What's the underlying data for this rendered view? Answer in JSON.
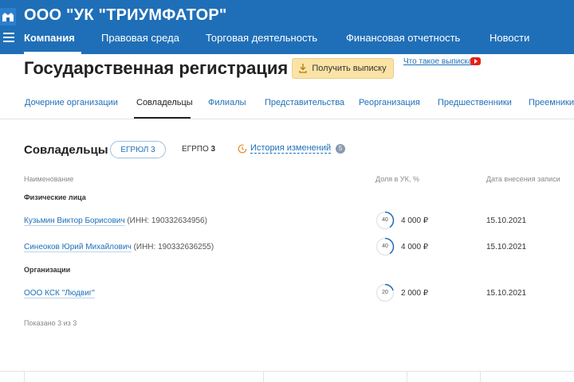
{
  "header": {
    "company_title": "ООО \"УК \"ТРИУМФАТОР\"",
    "nav": [
      {
        "label": "Компания",
        "active": true
      },
      {
        "label": "Правовая среда",
        "active": false
      },
      {
        "label": "Торговая деятельность",
        "active": false
      },
      {
        "label": "Финансовая отчетность",
        "active": false
      },
      {
        "label": "Новости",
        "active": false
      }
    ]
  },
  "page": {
    "title": "Государственная регистрация",
    "extract_button": "Получить выписку",
    "what_is_extract": "Что такое выписка"
  },
  "subtabs": [
    {
      "label": "Дочерние организации",
      "active": false
    },
    {
      "label": "Совладельцы",
      "active": true
    },
    {
      "label": "Филиалы",
      "active": false
    },
    {
      "label": "Представительства",
      "active": false
    },
    {
      "label": "Реорганизация",
      "active": false
    },
    {
      "label": "Предшественники",
      "active": false
    },
    {
      "label": "Преемники",
      "active": false
    }
  ],
  "section": {
    "title": "Совладельцы",
    "egrul_label": "ЕГРЮЛ 3",
    "egrpo_label": "ЕГРПО",
    "egrpo_count": "3",
    "history_label": "История изменений",
    "history_count": "5"
  },
  "table": {
    "headers": {
      "name": "Наименование",
      "share": "Доля в УК, %",
      "date": "Дата внесения записи"
    },
    "groups": {
      "individuals": "Физические лица",
      "organizations": "Организации"
    },
    "rows": [
      {
        "name": "Кузьмин Виктор Борисович",
        "inn": "(ИНН: 190332634956)",
        "percent": "40",
        "percent_value": 40,
        "amount": "4 000 ₽",
        "date": "15.10.2021"
      },
      {
        "name": "Синеоков Юрий Михайлович",
        "inn": "(ИНН: 190332636255)",
        "percent": "40",
        "percent_value": 40,
        "amount": "4 000 ₽",
        "date": "15.10.2021"
      },
      {
        "name": "ООО КСК \"Людвиг\"",
        "inn": "",
        "percent": "20",
        "percent_value": 20,
        "amount": "2 000 ₽",
        "date": "15.10.2021"
      }
    ],
    "shown_text": "Показано 3 из 3"
  },
  "colors": {
    "header_bg": "#1f6fb8",
    "link": "#1f6fb8",
    "extract_btn_bg": "#fbe3a6",
    "share_ring": "#1f6fb8",
    "youtube": "#e62117"
  }
}
